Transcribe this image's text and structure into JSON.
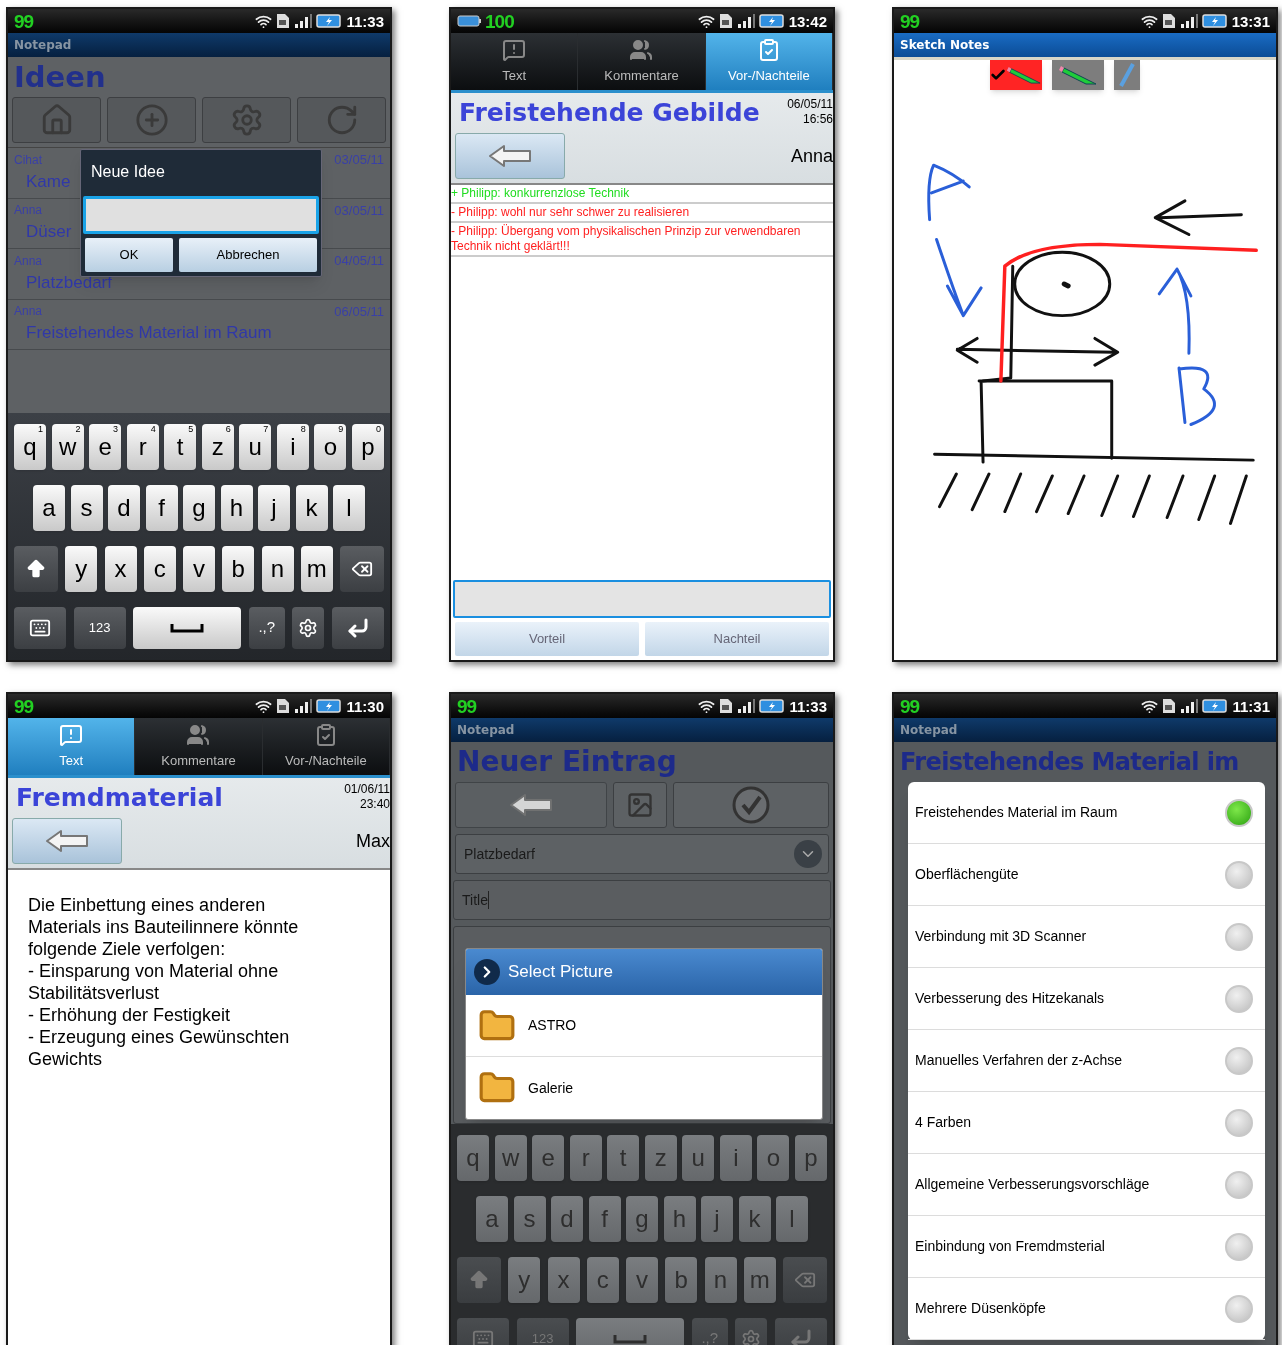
{
  "phones": [
    {
      "kind": "notepad_list",
      "status": {
        "badge": "99",
        "time": "11:33",
        "battery_widget": false
      },
      "app_title": "Notepad",
      "heading": "Ideen",
      "entries": [
        {
          "author": "Cihat",
          "date": "03/05/11",
          "title": "Kame"
        },
        {
          "author": "Anna",
          "date": "03/05/11",
          "title": "Düser"
        },
        {
          "author": "Anna",
          "date": "04/05/11",
          "title": "Platzbedarf"
        },
        {
          "author": "Anna",
          "date": "06/05/11",
          "title": "Freistehendes Material im Raum"
        }
      ],
      "dialog": {
        "title": "Neue Idee",
        "buttons": [
          "OK",
          "Abbrechen"
        ]
      },
      "keyboard": {
        "dimmed": false,
        "rows": [
          [
            "q",
            "w",
            "e",
            "r",
            "t",
            "z",
            "u",
            "i",
            "o",
            "p"
          ],
          [
            "a",
            "s",
            "d",
            "f",
            "g",
            "h",
            "j",
            "k",
            "l"
          ],
          [
            "y",
            "x",
            "c",
            "v",
            "b",
            "n",
            "m"
          ]
        ],
        "hints": [
          "1",
          "2",
          "3",
          "4",
          "5",
          "6",
          "7",
          "8",
          "9",
          "0"
        ],
        "symbols_key": "123",
        "punct_key": ".,?"
      }
    },
    {
      "kind": "pros_cons",
      "status": {
        "badge": "100",
        "time": "13:42",
        "battery_widget": true
      },
      "tabs": [
        {
          "label": "Text",
          "selected": false
        },
        {
          "label": "Kommentare",
          "selected": false
        },
        {
          "label": "Vor-/Nachteile",
          "selected": true
        }
      ],
      "title": "Freistehende Gebilde",
      "date": "06/05/11",
      "time": "16:56",
      "author": "Anna",
      "items": [
        {
          "kind": "pro",
          "text": "+ Philipp: konkurrenzlose Technik"
        },
        {
          "kind": "con",
          "text": "- Philipp: wohl nur sehr schwer zu realisieren"
        },
        {
          "kind": "con",
          "text": "- Philipp: Übergang vom physikalischen Prinzip zur verwendbaren Technik nicht geklärt!!!"
        }
      ],
      "buttons": [
        "Vorteil",
        "Nachteil"
      ]
    },
    {
      "kind": "sketch",
      "status": {
        "badge": "99",
        "time": "13:31",
        "battery_widget": false
      },
      "app_title": "Sketch Notes",
      "tools": [
        {
          "kind": "pencil",
          "selected": true
        },
        {
          "kind": "pencil",
          "selected": false
        },
        {
          "kind": "pen",
          "selected": false
        }
      ]
    },
    {
      "kind": "text_detail",
      "status": {
        "badge": "99",
        "time": "11:30",
        "battery_widget": false
      },
      "tabs": [
        {
          "label": "Text",
          "selected": true
        },
        {
          "label": "Kommentare",
          "selected": false
        },
        {
          "label": "Vor-/Nachteile",
          "selected": false
        }
      ],
      "title": "Fremdmaterial",
      "date": "01/06/11",
      "time": "23:40",
      "author": "Max",
      "body": [
        "Die Einbettung eines anderen Materials ins Bauteilinnere könnte folgende Ziele verfolgen:",
        "- Einsparung von Material ohne Stabilitätsverlust",
        "- Erhöhung der Festigkeit",
        "- Erzeugung eines Gewünschten Gewichts"
      ]
    },
    {
      "kind": "new_entry",
      "status": {
        "badge": "99",
        "time": "11:33",
        "battery_widget": false
      },
      "app_title": "Notepad",
      "heading": "Neuer Eintrag",
      "category": "Platzbedarf",
      "title_value": "Title",
      "dialog": {
        "title": "Select Picture",
        "options": [
          "ASTRO",
          "Galerie"
        ]
      },
      "keyboard": {
        "dimmed": true,
        "rows": [
          [
            "q",
            "w",
            "e",
            "r",
            "t",
            "z",
            "u",
            "i",
            "o",
            "p"
          ],
          [
            "a",
            "s",
            "d",
            "f",
            "g",
            "h",
            "j",
            "k",
            "l"
          ],
          [
            "y",
            "x",
            "c",
            "v",
            "b",
            "n",
            "m"
          ]
        ],
        "symbols_key": "123",
        "punct_key": ".,?"
      }
    },
    {
      "kind": "choice_list",
      "status": {
        "badge": "99",
        "time": "11:31",
        "battery_widget": false
      },
      "app_title": "Notepad",
      "heading": "Freistehendes Material im",
      "options": [
        {
          "label": "Freistehendes Material im Raum",
          "selected": true
        },
        {
          "label": "Oberflächengüte",
          "selected": false
        },
        {
          "label": "Verbindung mit 3D Scanner",
          "selected": false
        },
        {
          "label": "Verbesserung des Hitzekanals",
          "selected": false
        },
        {
          "label": "Manuelles Verfahren der z-Achse",
          "selected": false
        },
        {
          "label": "4 Farben",
          "selected": false
        },
        {
          "label": "Allgemeine Verbesserungsvorschläge",
          "selected": false
        },
        {
          "label": "Einbindung von Fremdmsterial",
          "selected": false
        },
        {
          "label": "Mehrere Düsenköpfe",
          "selected": false
        }
      ]
    }
  ]
}
